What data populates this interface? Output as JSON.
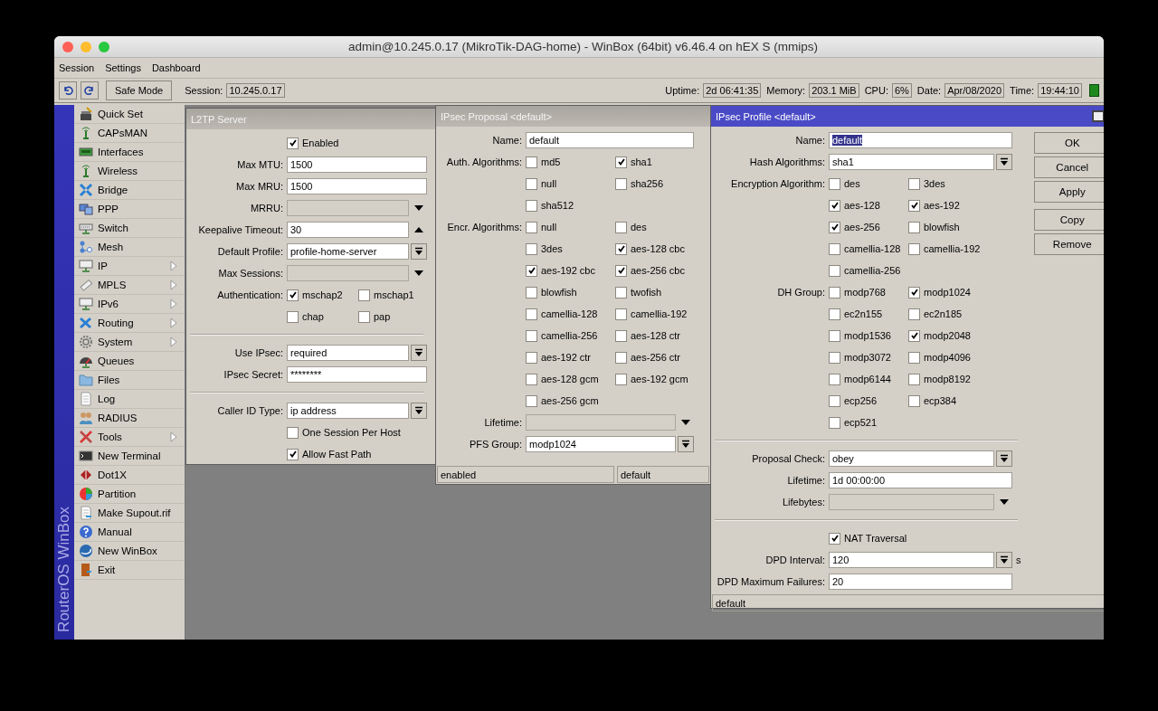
{
  "window": {
    "title": "admin@10.245.0.17 (MikroTik-DAG-home) - WinBox (64bit) v6.46.4 on hEX S (mmips)"
  },
  "menu": [
    "Session",
    "Settings",
    "Dashboard"
  ],
  "toolbar": {
    "safe_mode": "Safe Mode",
    "session_label": "Session:",
    "session": "10.245.0.17",
    "status": [
      {
        "label": "Uptime:",
        "value": "2d 06:41:35"
      },
      {
        "label": "Memory:",
        "value": "203.1 MiB"
      },
      {
        "label": "CPU:",
        "value": "6%"
      },
      {
        "label": "Date:",
        "value": "Apr/08/2020"
      },
      {
        "label": "Time:",
        "value": "19:44:10"
      }
    ]
  },
  "sidebar": {
    "brand": "RouterOS WinBox",
    "items": [
      {
        "label": "Quick Set",
        "submenu": false
      },
      {
        "label": "CAPsMAN",
        "submenu": false
      },
      {
        "label": "Interfaces",
        "submenu": false
      },
      {
        "label": "Wireless",
        "submenu": false
      },
      {
        "label": "Bridge",
        "submenu": false
      },
      {
        "label": "PPP",
        "submenu": false
      },
      {
        "label": "Switch",
        "submenu": false
      },
      {
        "label": "Mesh",
        "submenu": false
      },
      {
        "label": "IP",
        "submenu": true
      },
      {
        "label": "MPLS",
        "submenu": true
      },
      {
        "label": "IPv6",
        "submenu": true
      },
      {
        "label": "Routing",
        "submenu": true
      },
      {
        "label": "System",
        "submenu": true
      },
      {
        "label": "Queues",
        "submenu": false
      },
      {
        "label": "Files",
        "submenu": false
      },
      {
        "label": "Log",
        "submenu": false
      },
      {
        "label": "RADIUS",
        "submenu": false
      },
      {
        "label": "Tools",
        "submenu": true
      },
      {
        "label": "New Terminal",
        "submenu": false
      },
      {
        "label": "Dot1X",
        "submenu": false
      },
      {
        "label": "Partition",
        "submenu": false
      },
      {
        "label": "Make Supout.rif",
        "submenu": false
      },
      {
        "label": "Manual",
        "submenu": false
      },
      {
        "label": "New WinBox",
        "submenu": false
      },
      {
        "label": "Exit",
        "submenu": false
      }
    ]
  },
  "l2tp_server": {
    "title": "L2TP Server",
    "active": false,
    "rows": [
      {
        "kind": "checkbox",
        "text": "Enabled",
        "checked": true
      },
      {
        "kind": "text",
        "label": "Max MTU:",
        "value": "1500"
      },
      {
        "kind": "text",
        "label": "Max MRU:",
        "value": "1500"
      },
      {
        "kind": "optional",
        "label": "MRRU:",
        "enabled": false
      },
      {
        "kind": "optional",
        "label": "Keepalive Timeout:",
        "value": "30",
        "enabled": true
      },
      {
        "kind": "dropdown",
        "label": "Default Profile:",
        "value": "profile-home-server"
      },
      {
        "kind": "optional",
        "label": "Max Sessions:",
        "enabled": false
      },
      {
        "kind": "checks",
        "label": "Authentication:",
        "options": [
          {
            "text": "mschap2",
            "checked": true
          },
          {
            "text": "mschap1",
            "checked": false
          },
          {
            "text": "chap",
            "checked": false
          },
          {
            "text": "pap",
            "checked": false
          }
        ]
      },
      {
        "kind": "separator"
      },
      {
        "kind": "dropdown",
        "label": "Use IPsec:",
        "value": "required"
      },
      {
        "kind": "text",
        "label": "IPsec Secret:",
        "value": "********"
      },
      {
        "kind": "separator"
      },
      {
        "kind": "dropdown",
        "label": "Caller ID Type:",
        "value": "ip address"
      },
      {
        "kind": "checkbox",
        "text": "One Session Per Host",
        "checked": false
      },
      {
        "kind": "checkbox",
        "text": "Allow Fast Path",
        "checked": true
      }
    ]
  },
  "ipsec_proposal": {
    "title": "IPsec Proposal <default>",
    "active": false,
    "rows": [
      {
        "kind": "text",
        "label": "Name:",
        "value": "default"
      },
      {
        "kind": "checks",
        "label": "Auth. Algorithms:",
        "options": [
          {
            "text": "md5",
            "checked": false
          },
          {
            "text": "sha1",
            "checked": true
          },
          {
            "text": "null",
            "checked": false
          },
          {
            "text": "sha256",
            "checked": false
          },
          {
            "text": "sha512",
            "checked": false
          }
        ]
      },
      {
        "kind": "checks",
        "label": "Encr. Algorithms:",
        "options": [
          {
            "text": "null",
            "checked": false
          },
          {
            "text": "des",
            "checked": false
          },
          {
            "text": "3des",
            "checked": false
          },
          {
            "text": "aes-128 cbc",
            "checked": true
          },
          {
            "text": "aes-192 cbc",
            "checked": true
          },
          {
            "text": "aes-256 cbc",
            "checked": true
          },
          {
            "text": "blowfish",
            "checked": false
          },
          {
            "text": "twofish",
            "checked": false
          },
          {
            "text": "camellia-128",
            "checked": false
          },
          {
            "text": "camellia-192",
            "checked": false
          },
          {
            "text": "camellia-256",
            "checked": false
          },
          {
            "text": "aes-128 ctr",
            "checked": false
          },
          {
            "text": "aes-192 ctr",
            "checked": false
          },
          {
            "text": "aes-256 ctr",
            "checked": false
          },
          {
            "text": "aes-128 gcm",
            "checked": false
          },
          {
            "text": "aes-192 gcm",
            "checked": false
          },
          {
            "text": "aes-256 gcm",
            "checked": false
          }
        ]
      },
      {
        "kind": "optional",
        "label": "Lifetime:",
        "enabled": false
      },
      {
        "kind": "dropdown",
        "label": "PFS Group:",
        "value": "modp1024"
      }
    ],
    "status": [
      "enabled",
      "default"
    ]
  },
  "ipsec_profile": {
    "title": "IPsec Profile <default>",
    "active": true,
    "rows": [
      {
        "kind": "text",
        "label": "Name:",
        "value": "default",
        "text_selected": true
      },
      {
        "kind": "dropdown",
        "label": "Hash Algorithms:",
        "value": "sha1"
      },
      {
        "kind": "checks",
        "label": "Encryption Algorithm:",
        "options": [
          {
            "text": "des",
            "checked": false
          },
          {
            "text": "3des",
            "checked": false
          },
          {
            "text": "aes-128",
            "checked": true
          },
          {
            "text": "aes-192",
            "checked": true
          },
          {
            "text": "aes-256",
            "checked": true
          },
          {
            "text": "blowfish",
            "checked": false
          },
          {
            "text": "camellia-128",
            "checked": false
          },
          {
            "text": "camellia-192",
            "checked": false
          },
          {
            "text": "camellia-256",
            "checked": false
          }
        ]
      },
      {
        "kind": "checks",
        "label": "DH Group:",
        "options": [
          {
            "text": "modp768",
            "checked": false
          },
          {
            "text": "modp1024",
            "checked": true
          },
          {
            "text": "ec2n155",
            "checked": false
          },
          {
            "text": "ec2n185",
            "checked": false
          },
          {
            "text": "modp1536",
            "checked": false
          },
          {
            "text": "modp2048",
            "checked": true
          },
          {
            "text": "modp3072",
            "checked": false
          },
          {
            "text": "modp4096",
            "checked": false
          },
          {
            "text": "modp6144",
            "checked": false
          },
          {
            "text": "modp8192",
            "checked": false
          },
          {
            "text": "ecp256",
            "checked": false
          },
          {
            "text": "ecp384",
            "checked": false
          },
          {
            "text": "ecp521",
            "checked": false
          }
        ]
      },
      {
        "kind": "separator"
      },
      {
        "kind": "dropdown",
        "label": "Proposal Check:",
        "value": "obey"
      },
      {
        "kind": "text",
        "label": "Lifetime:",
        "value": "1d 00:00:00"
      },
      {
        "kind": "optional",
        "label": "Lifebytes:",
        "enabled": false
      },
      {
        "kind": "separator"
      },
      {
        "kind": "checkbox",
        "text": "NAT Traversal",
        "checked": true
      },
      {
        "kind": "dropdown",
        "label": "DPD Interval:",
        "value": "120",
        "unit": "s"
      },
      {
        "kind": "text",
        "label": "DPD Maximum Failures:",
        "value": "20"
      }
    ],
    "buttons": [
      [
        "OK",
        "Cancel",
        "Apply"
      ],
      [
        "Copy",
        "Remove"
      ]
    ],
    "status": [
      "default"
    ]
  }
}
